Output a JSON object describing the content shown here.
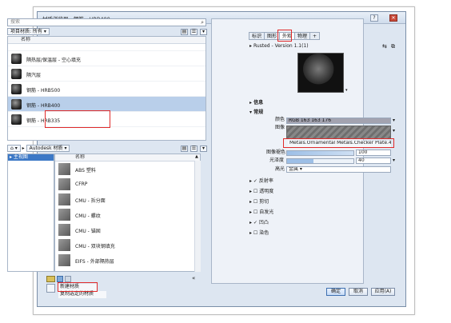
{
  "window": {
    "title": "材质浏览器 - 钢筋 - HRB400"
  },
  "library_panel": {
    "search_placeholder": "搜索",
    "project_filter_label": "项目材质: 所有",
    "column_header": "名称",
    "materials": [
      {
        "label": ""
      },
      {
        "label": "隔热层/保温层 - 空心填充"
      },
      {
        "label": "隔汽层"
      },
      {
        "label": "钢筋 - HRB500"
      },
      {
        "label": "钢筋 - HRB400",
        "selected": true
      },
      {
        "label": "钢筋 - HRB335"
      }
    ]
  },
  "autodesk_library": {
    "breadcrumb": "Autodesk 材质",
    "home_icon": "home-icon",
    "tree_selected": "▸ 主视图",
    "column_header": "名称",
    "items": [
      {
        "label": "ABS 塑料"
      },
      {
        "label": "CFRP"
      },
      {
        "label": "CMU - 拆分面"
      },
      {
        "label": "CMU - 螺纹"
      },
      {
        "label": "CMU - 锚固"
      },
      {
        "label": "CMU - 双块钢填充"
      },
      {
        "label": "EIFS - 外部隔热层"
      }
    ]
  },
  "bottom_menu": {
    "new_material": "新建材质",
    "duplicate_material": "复制选定的材质"
  },
  "editor": {
    "tabs": [
      {
        "label": "标识"
      },
      {
        "label": "图形"
      },
      {
        "label": "外观"
      },
      {
        "label": "物理"
      },
      {
        "label": "+"
      }
    ],
    "asset_name": "Rusted - Version 1.1(1)",
    "info_section": "信息",
    "generic_section": "常规",
    "color_label": "颜色",
    "color_value": "RGB 163 163 176",
    "image_label": "图像",
    "image_path": "Metals.Ornamental Metals.Checker Plate.4Sd...",
    "image_fade_label": "图像褪色",
    "image_fade_value": "100",
    "glossiness_label": "光泽度",
    "glossiness_value": "40",
    "highlights_label": "高光",
    "highlights_value": "金属",
    "sections": [
      {
        "label": "反射率",
        "checked": true
      },
      {
        "label": "透明度",
        "checked": false
      },
      {
        "label": "剪切",
        "checked": false
      },
      {
        "label": "自发光",
        "checked": false
      },
      {
        "label": "凹凸",
        "checked": true
      },
      {
        "label": "染色",
        "checked": false
      }
    ]
  },
  "footer": {
    "ok": "确定",
    "cancel": "取消",
    "apply": "应用(A)"
  },
  "colors": {
    "highlight": "#e02a2a",
    "selection": "#b9cfea",
    "accent": "#3c78c6"
  }
}
